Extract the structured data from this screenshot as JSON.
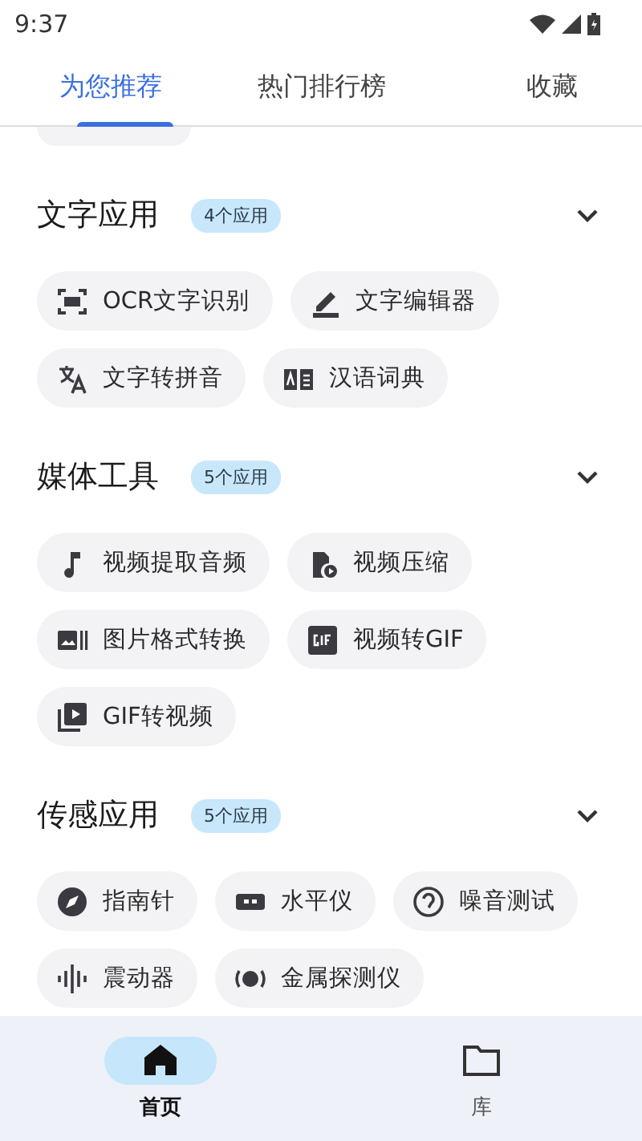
{
  "status_bar": {
    "time": "9:37"
  },
  "tabs": [
    {
      "label": "为您推荐",
      "selected": true
    },
    {
      "label": "热门排行榜",
      "selected": false
    },
    {
      "label": "收藏",
      "selected": false
    }
  ],
  "sections": [
    {
      "title": "文字应用",
      "badge": "4个应用",
      "expanded": true,
      "items": [
        "OCR文字识别",
        "文字编辑器",
        "文字转拼音",
        "汉语词典"
      ]
    },
    {
      "title": "媒体工具",
      "badge": "5个应用",
      "expanded": true,
      "items": [
        "视频提取音频",
        "视频压缩",
        "图片格式转换",
        "视频转GIF",
        "GIF转视频"
      ]
    },
    {
      "title": "传感应用",
      "badge": "5个应用",
      "expanded": true,
      "items": [
        "指南针",
        "水平仪",
        "噪音测试",
        "震动器",
        "金属探测仪"
      ]
    }
  ],
  "bottom_nav": [
    {
      "label": "首页",
      "selected": true
    },
    {
      "label": "库",
      "selected": false
    }
  ]
}
